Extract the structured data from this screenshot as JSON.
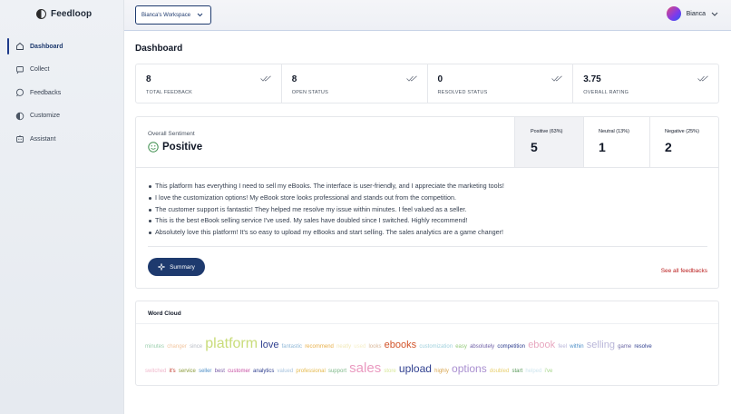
{
  "app": {
    "name": "Feedloop"
  },
  "sidebar": {
    "items": [
      {
        "label": "Dashboard",
        "icon": "home-icon",
        "active": true
      },
      {
        "label": "Collect",
        "icon": "collect-icon"
      },
      {
        "label": "Feedbacks",
        "icon": "chat-icon"
      },
      {
        "label": "Customize",
        "icon": "customize-icon"
      },
      {
        "label": "Assistant",
        "icon": "assistant-icon"
      }
    ]
  },
  "header": {
    "workspace": "Bianca's Workspace",
    "user_name": "Bianca"
  },
  "page": {
    "title": "Dashboard"
  },
  "stats": [
    {
      "value": "8",
      "label": "TOTAL FEEDBACK"
    },
    {
      "value": "8",
      "label": "OPEN STATUS"
    },
    {
      "value": "0",
      "label": "RESOLVED STATUS"
    },
    {
      "value": "3.75",
      "label": "OVERALL RATING"
    }
  ],
  "sentiment": {
    "overall_label": "Overall Sentiment",
    "overall_value": "Positive",
    "positive": {
      "label": "Positive (63%)",
      "value": "5",
      "percent": 63
    },
    "neutral": {
      "label": "Neutral (13%)",
      "value": "1",
      "percent": 13
    },
    "negative": {
      "label": "Negative (25%)",
      "value": "2",
      "percent": 25
    },
    "feedbacks": [
      "This platform has everything I need to sell my eBooks. The interface is user-friendly, and I appreciate the marketing tools!",
      "I love the customization options! My eBook store looks professional and stands out from the competition.",
      "The customer support is fantastic! They helped me resolve my issue within minutes. I feel valued as a seller.",
      "This is the best eBook selling service I've used. My sales have doubled since I switched. Highly recommend!",
      "Absolutely love this platform! It's so easy to upload my eBooks and start selling. The sales analytics are a game changer!"
    ],
    "summary_button": "Summary",
    "see_all": "See all feedbacks"
  },
  "word_cloud": {
    "title": "Word Cloud",
    "rows": [
      [
        {
          "w": "minutes",
          "s": 6,
          "c": "#9ccfae"
        },
        {
          "w": "changer",
          "s": 6,
          "c": "#f2c6a0"
        },
        {
          "w": "since",
          "s": 6,
          "c": "#b8bcc4"
        },
        {
          "w": "platform",
          "s": 16,
          "c": "#c9dc7a"
        },
        {
          "w": "love",
          "s": 11,
          "c": "#2f3f8f"
        },
        {
          "w": "fantastic",
          "s": 6,
          "c": "#8fb7d6"
        },
        {
          "w": "recommend",
          "s": 6,
          "c": "#e8b04a"
        },
        {
          "w": "neatly",
          "s": 6,
          "c": "#f1e9b8"
        },
        {
          "w": "used",
          "s": 6,
          "c": "#f6efc8"
        },
        {
          "w": "looks",
          "s": 6,
          "c": "#d9b89a"
        },
        {
          "w": "ebooks",
          "s": 11,
          "c": "#d2542a"
        },
        {
          "w": "customization",
          "s": 6,
          "c": "#9fd0dc"
        },
        {
          "w": "easy",
          "s": 6,
          "c": "#94c97a"
        },
        {
          "w": "absolutely",
          "s": 6,
          "c": "#6e5fa6"
        },
        {
          "w": "competition",
          "s": 6,
          "c": "#2f3f8f"
        },
        {
          "w": "ebook",
          "s": 11,
          "c": "#e8a8c0"
        },
        {
          "w": "feel",
          "s": 6,
          "c": "#b9b6d9"
        },
        {
          "w": "within",
          "s": 6,
          "c": "#4e8fc7"
        },
        {
          "w": "selling",
          "s": 11,
          "c": "#b9b6d9"
        },
        {
          "w": "game",
          "s": 6,
          "c": "#6e6aa6"
        },
        {
          "w": "resolve",
          "s": 6,
          "c": "#2f3f8f"
        }
      ],
      [
        {
          "w": "switched",
          "s": 6,
          "c": "#f0b8cc"
        },
        {
          "w": "it's",
          "s": 6,
          "c": "#c0392b"
        },
        {
          "w": "service",
          "s": 6,
          "c": "#8a9a3a"
        },
        {
          "w": "seller",
          "s": 6,
          "c": "#4e8fc7"
        },
        {
          "w": "best",
          "s": 6,
          "c": "#7b5ea7"
        },
        {
          "w": "customer",
          "s": 6,
          "c": "#c74fa3"
        },
        {
          "w": "analytics",
          "s": 6,
          "c": "#2f3f8f"
        },
        {
          "w": "valued",
          "s": 6,
          "c": "#a9c4df"
        },
        {
          "w": "professional",
          "s": 6,
          "c": "#e4b84a"
        },
        {
          "w": "support",
          "s": 6,
          "c": "#7fb98a"
        },
        {
          "w": "sales",
          "s": 15,
          "c": "#ea9ac0"
        },
        {
          "w": "store",
          "s": 6,
          "c": "#d8e89a"
        },
        {
          "w": "upload",
          "s": 12,
          "c": "#2f3f8f"
        },
        {
          "w": "highly",
          "s": 6,
          "c": "#d9a650"
        },
        {
          "w": "options",
          "s": 12,
          "c": "#a98fd0"
        },
        {
          "w": "doubled",
          "s": 6,
          "c": "#e8d070"
        },
        {
          "w": "start",
          "s": 6,
          "c": "#5a9a5a"
        },
        {
          "w": "helped",
          "s": 6,
          "c": "#cfe6ef"
        },
        {
          "w": "i've",
          "s": 6,
          "c": "#a6d68a"
        }
      ]
    ]
  },
  "colors": {
    "accent": "#1e3a6e",
    "link_red": "#b91c1c"
  }
}
